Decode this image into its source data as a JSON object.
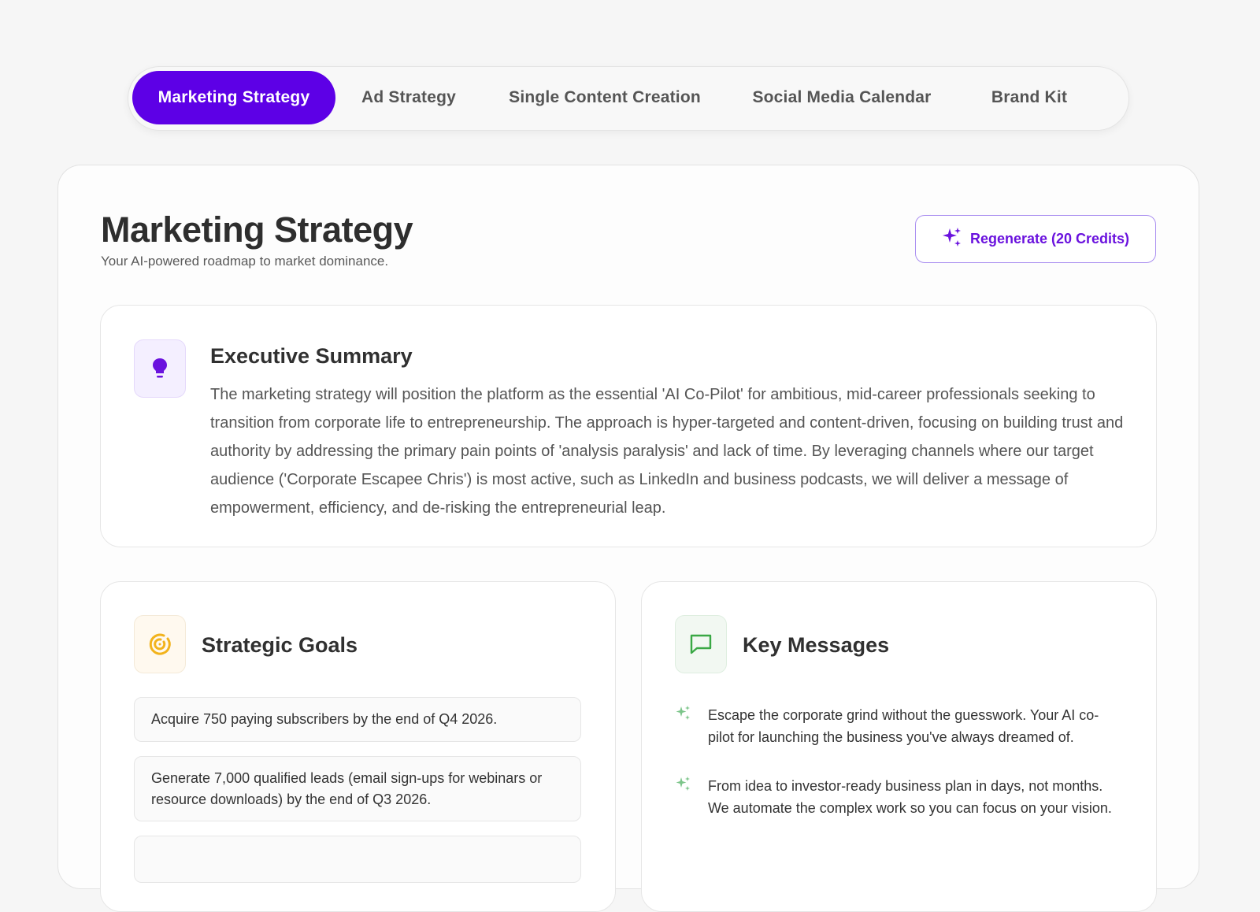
{
  "tabs": [
    {
      "label": "Marketing Strategy",
      "active": true
    },
    {
      "label": "Ad Strategy",
      "active": false
    },
    {
      "label": "Single Content Creation",
      "active": false
    },
    {
      "label": "Social Media Calendar",
      "active": false
    },
    {
      "label": "Brand Kit",
      "active": false
    }
  ],
  "header": {
    "title": "Marketing Strategy",
    "subtitle": "Your AI-powered roadmap to market dominance.",
    "regenerate_label": "Regenerate (20 Credits)"
  },
  "executive_summary": {
    "title": "Executive Summary",
    "icon": "lightbulb-icon",
    "body": "The marketing strategy will position the platform as the essential 'AI Co-Pilot' for ambitious, mid-career professionals seeking to transition from corporate life to entrepreneurship. The approach is hyper-targeted and content-driven, focusing on building trust and authority by addressing the primary pain points of 'analysis paralysis' and lack of time. By leveraging channels where our target audience ('Corporate Escapee Chris') is most active, such as LinkedIn and business podcasts, we will deliver a message of empowerment, efficiency, and de-risking the entrepreneurial leap."
  },
  "strategic_goals": {
    "title": "Strategic Goals",
    "icon": "target-icon",
    "items": [
      "Acquire 750 paying subscribers by the end of Q4 2026.",
      "Generate 7,000 qualified leads (email sign-ups for webinars or resource downloads) by the end of Q3 2026."
    ]
  },
  "key_messages": {
    "title": "Key Messages",
    "icon": "message-square-icon",
    "items": [
      "Escape the corporate grind without the guesswork. Your AI co-pilot for launching the business you've always dreamed of.",
      "From idea to investor-ready business plan in days, not months. We automate the complex work so you can focus on your vision."
    ]
  },
  "colors": {
    "accent": "#5d00e6",
    "goal_icon": "#f2b31c",
    "message_icon": "#3aa845",
    "sparkle_green": "#7cc58a"
  }
}
